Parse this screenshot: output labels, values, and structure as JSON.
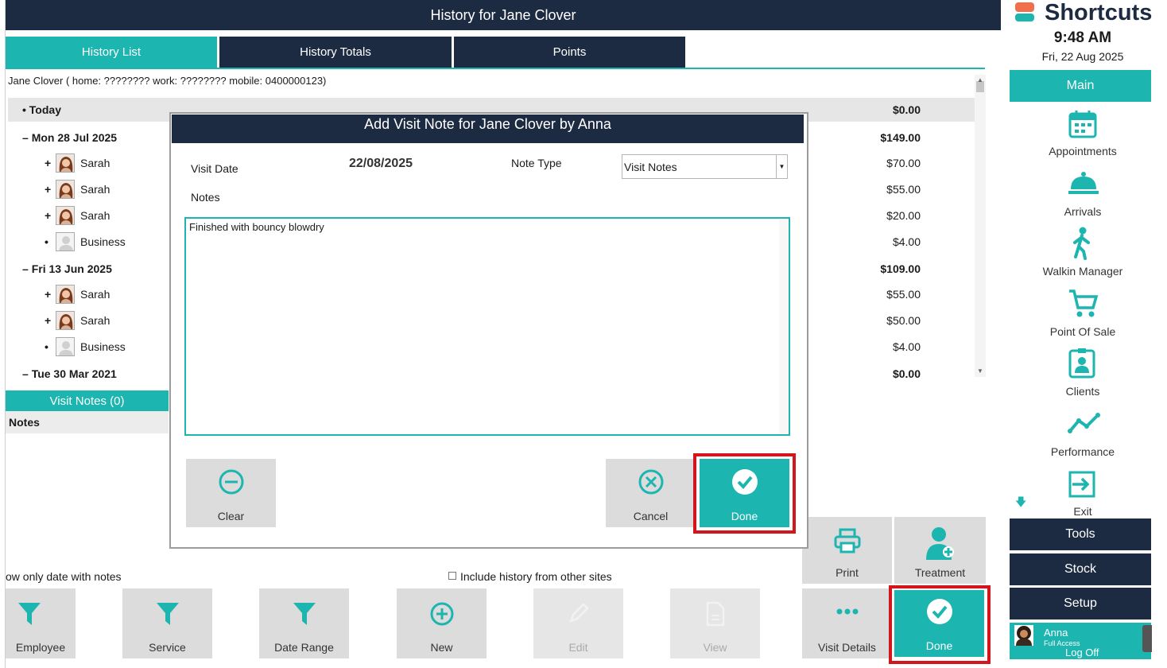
{
  "window": {
    "title": "History for Jane Clover"
  },
  "tabs": [
    {
      "label": "History List",
      "active": true
    },
    {
      "label": "History Totals",
      "active": false
    },
    {
      "label": "Points",
      "active": false
    }
  ],
  "client_line": "Jane Clover ( home: ????????  work: ????????  mobile: 0400000123)",
  "history": {
    "today": {
      "label": "Today",
      "amount": "$0.00"
    },
    "groups": [
      {
        "label": "Mon 28 Jul 2025",
        "amount": "$149.00",
        "items": [
          {
            "mark": "+",
            "name": "Sarah",
            "amount": "$70.00",
            "avatar": "photo"
          },
          {
            "mark": "+",
            "name": "Sarah",
            "amount": "$55.00",
            "avatar": "photo"
          },
          {
            "mark": "+",
            "name": "Sarah",
            "amount": "$20.00",
            "avatar": "photo"
          },
          {
            "mark": "•",
            "name": "Business",
            "amount": "$4.00",
            "avatar": "placeholder"
          }
        ]
      },
      {
        "label": "Fri 13 Jun 2025",
        "amount": "$109.00",
        "items": [
          {
            "mark": "+",
            "name": "Sarah",
            "amount": "$55.00",
            "avatar": "photo"
          },
          {
            "mark": "+",
            "name": "Sarah",
            "amount": "$50.00",
            "avatar": "photo"
          },
          {
            "mark": "•",
            "name": "Business",
            "amount": "$4.00",
            "avatar": "placeholder"
          }
        ]
      },
      {
        "label": "Tue 30 Mar 2021",
        "amount": "$0.00",
        "items": []
      }
    ]
  },
  "visit_notes": {
    "header": "Visit Notes (0)",
    "column": "Notes"
  },
  "options": {
    "show_only_notes": "ow only date with notes",
    "include_other_sites": "Include history from other sites"
  },
  "toolbar": {
    "employee": "Employee",
    "service": "Service",
    "date_range": "Date Range",
    "new": "New",
    "edit": "Edit",
    "view": "View",
    "visit_details": "Visit Details",
    "done": "Done",
    "print": "Print",
    "treatment": "Treatment"
  },
  "dialog": {
    "title": "Add Visit Note for Jane Clover by Anna",
    "visit_date_label": "Visit Date",
    "visit_date_value": "22/08/2025",
    "note_type_label": "Note Type",
    "note_type_value": "Visit Notes",
    "notes_label": "Notes",
    "notes_value": "Finished with bouncy blowdry",
    "clear": "Clear",
    "cancel": "Cancel",
    "done": "Done"
  },
  "sidebar": {
    "title": "Shortcuts",
    "time": "9:48 AM",
    "date": "Fri, 22 Aug 2025",
    "main": "Main",
    "items": [
      {
        "label": "Appointments",
        "icon": "calendar-icon"
      },
      {
        "label": "Arrivals",
        "icon": "bell-icon"
      },
      {
        "label": "Walkin Manager",
        "icon": "walking-person-icon"
      },
      {
        "label": "Point Of Sale",
        "icon": "cart-icon"
      },
      {
        "label": "Clients",
        "icon": "client-card-icon"
      },
      {
        "label": "Performance",
        "icon": "trend-icon"
      },
      {
        "label": "Exit",
        "icon": "exit-icon"
      }
    ],
    "tools": "Tools",
    "stock": "Stock",
    "setup": "Setup",
    "user": {
      "name": "Anna",
      "access": "Full Access",
      "logoff": "Log Off"
    }
  },
  "colors": {
    "navy": "#1d2b42",
    "teal": "#1cb5b0",
    "highlight": "#d3151c"
  }
}
